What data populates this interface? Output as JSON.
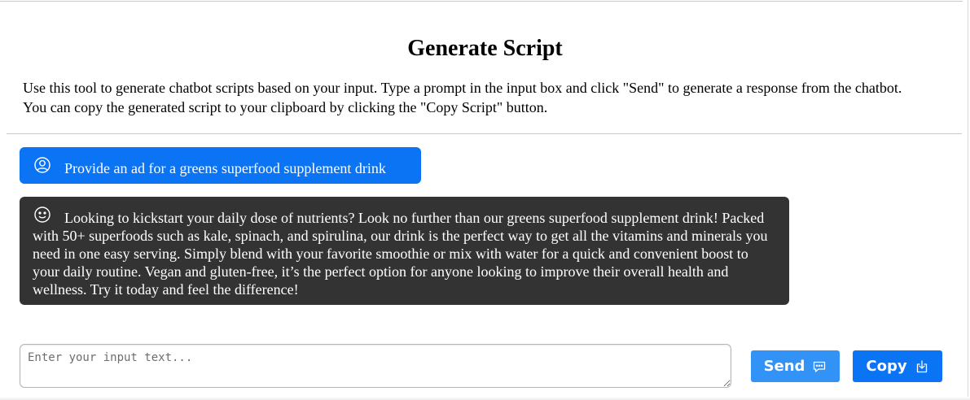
{
  "page": {
    "title": "Generate Script",
    "description": "Use this tool to generate chatbot scripts based on your input. Type a prompt in the input box and click \"Send\" to generate a response from the chatbot. You can copy the generated script to your clipboard by clicking the \"Copy Script\" button."
  },
  "messages": [
    {
      "role": "user",
      "icon": "user-circle-icon",
      "text": "Provide an ad for a greens superfood supplement drink"
    },
    {
      "role": "bot",
      "icon": "smiley-face-icon",
      "text": "Looking to kickstart your daily dose of nutrients? Look no further than our greens superfood supplement drink! Packed with 50+ superfoods such as kale, spinach, and spirulina, our drink is the perfect way to get all the vitamins and minerals you need in one easy serving. Simply blend with your favorite smoothie or mix with water for a quick and convenient boost to your daily routine. Vegan and gluten-free, it’s the perfect option for anyone looking to improve their overall health and wellness. Try it today and feel the difference!"
    }
  ],
  "input": {
    "placeholder": "Enter your input text...",
    "value": ""
  },
  "buttons": {
    "send_label": "Send",
    "send_icon": "chat-bubble-icon",
    "copy_label": "Copy",
    "copy_icon": "download-icon"
  },
  "colors": {
    "user_bubble": "#0a74f5",
    "bot_bubble": "#333333",
    "send_button": "#3292f5",
    "copy_button": "#0a74f5"
  }
}
